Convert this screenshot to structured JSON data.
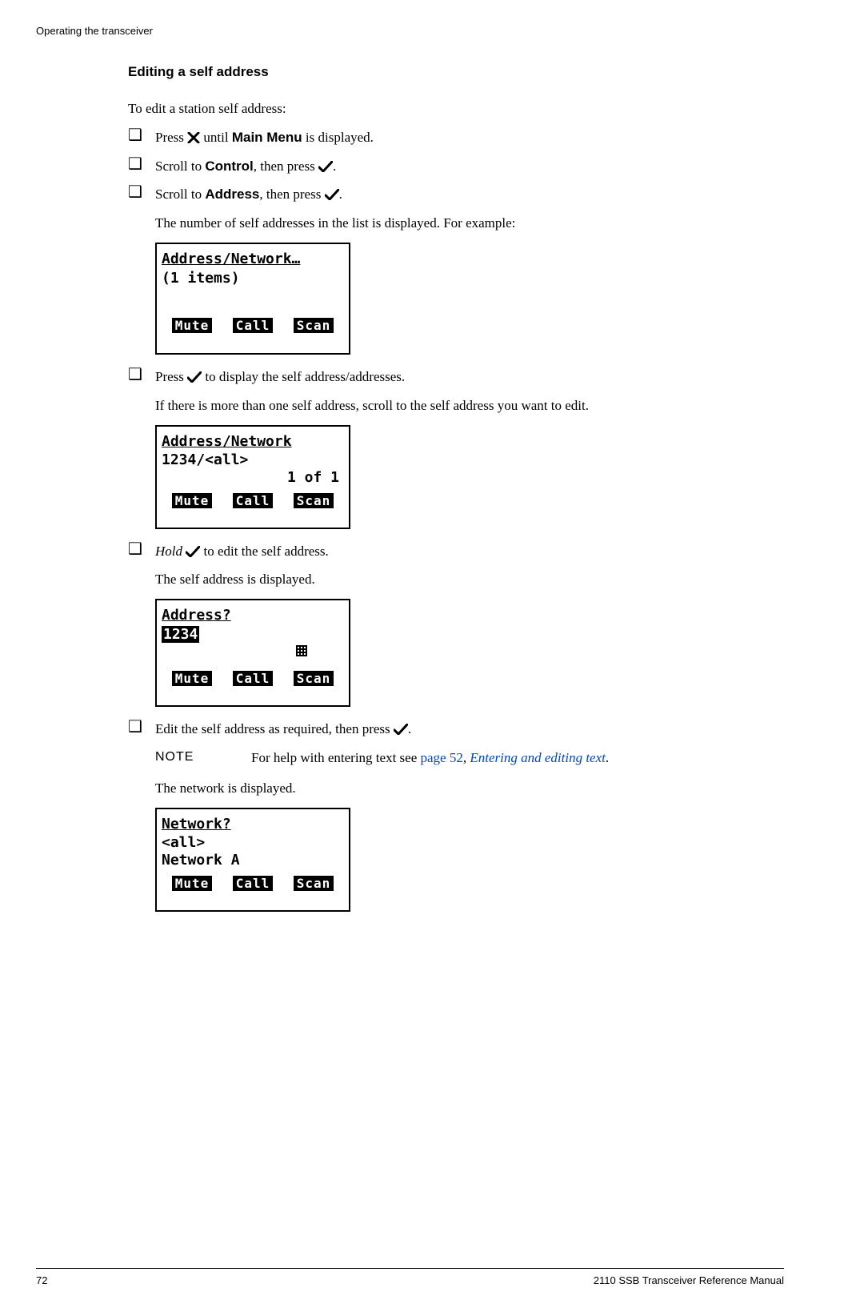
{
  "header": "Operating the transceiver",
  "section_title": "Editing a self address",
  "intro": "To edit a station self address:",
  "steps": {
    "s1": {
      "press": "Press ",
      "until": " until ",
      "menu": "Main Menu",
      "tail": " is displayed."
    },
    "s2": {
      "scroll": "Scroll to ",
      "item": "Control",
      "then": ", then press ",
      "dot": "."
    },
    "s3": {
      "scroll": "Scroll to ",
      "item": "Address",
      "then": ", then press ",
      "dot": "."
    },
    "s3_after": "The number of self addresses in the list is displayed. For example:",
    "s4": {
      "press": "Press ",
      "tail": " to display the self address/addresses."
    },
    "s4_after": "If there is more than one self address, scroll to the self address you want to edit.",
    "s5": {
      "hold": "Hold",
      "sp": " ",
      "tail": " to edit the self address."
    },
    "s5_after": "The self address is displayed.",
    "s6": {
      "text1": "Edit the self address as required, then press ",
      "dot": "."
    },
    "s6_note_label": "NOTE",
    "s6_note_prefix": "For help with entering text see ",
    "s6_note_link1": "page 52",
    "s6_note_comma": ", ",
    "s6_note_link2": "Entering and editing text",
    "s6_note_dot": ".",
    "s6_after": "The network is displayed."
  },
  "lcd1": {
    "title": "Address/Network…",
    "line1": "(1 items)",
    "soft": {
      "mute": "Mute",
      "call": "Call",
      "scan": "Scan"
    }
  },
  "lcd2": {
    "title": "Address/Network",
    "line1": "1234/<all>",
    "line2": "1 of 1",
    "soft": {
      "mute": "Mute",
      "call": "Call",
      "scan": "Scan"
    }
  },
  "lcd3": {
    "title": "Address?",
    "value": "1234",
    "soft": {
      "mute": "Mute",
      "call": "Call",
      "scan": "Scan"
    }
  },
  "lcd4": {
    "title": "Network?",
    "line1": "<all>",
    "line2": "Network A",
    "soft": {
      "mute": "Mute",
      "call": "Call",
      "scan": "Scan"
    }
  },
  "footer": {
    "page": "72",
    "manual": "2110 SSB Transceiver Reference Manual"
  }
}
